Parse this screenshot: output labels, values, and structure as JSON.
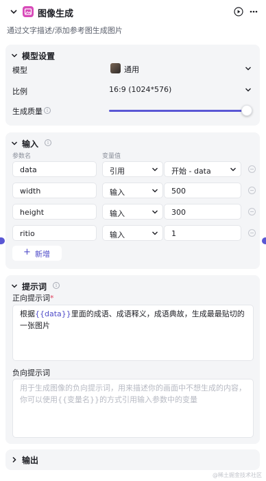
{
  "header": {
    "title": "图像生成",
    "subtitle": "通过文字描述/添加参考图生成图片",
    "icons": [
      "chevron-down-icon",
      "image-icon",
      "play-icon",
      "more-icon"
    ]
  },
  "model_settings": {
    "title": "模型设置",
    "model_label": "模型",
    "model_value": "通用",
    "ratio_label": "比例",
    "ratio_value": "16:9 (1024*576)",
    "quality_label": "生成质量",
    "quality_level": 0.97
  },
  "inputs": {
    "title": "输入",
    "col_name": "参数名",
    "col_value": "变量值",
    "rows": [
      {
        "name": "data",
        "type": "引用",
        "value": "开始 - data"
      },
      {
        "name": "width",
        "type": "输入",
        "value": "500"
      },
      {
        "name": "height",
        "type": "输入",
        "value": "300"
      },
      {
        "name": "ritio",
        "type": "输入",
        "value": "1"
      }
    ],
    "add_label": "新增"
  },
  "prompt": {
    "title": "提示词",
    "positive_label": "正向提示词",
    "required_mark": "*",
    "positive_pre": "根据",
    "positive_var": "{{data}}",
    "positive_post": "里面的成语、成语释义，成语典故，生成最最贴切的一张图片",
    "negative_label": "负向提示词",
    "negative_placeholder": "用于生成图像的负向提示词，用来描述你的画面中不想生成的内容，你可以使用{{变量名}}的方式引用输入参数中的变量"
  },
  "output": {
    "title": "输出"
  },
  "watermark": "@稀土掘金技术社区",
  "colors": {
    "accent": "#5a57d4",
    "node_icon": "#d84bb9",
    "card_bg": "#f4f5f7"
  }
}
